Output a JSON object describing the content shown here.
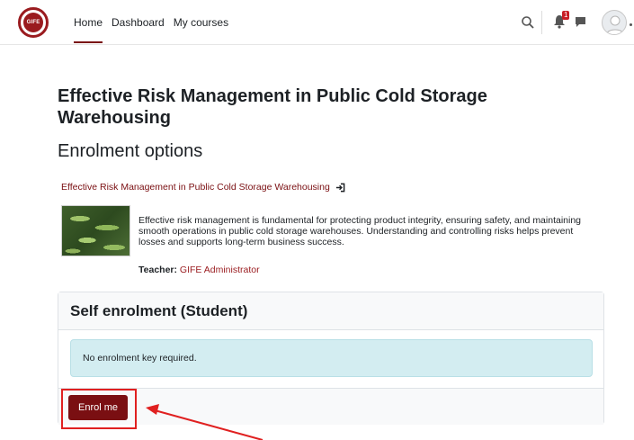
{
  "navbar": {
    "logo_text": "GIFE",
    "links": [
      {
        "label": "Home",
        "active": true
      },
      {
        "label": "Dashboard",
        "active": false
      },
      {
        "label": "My courses",
        "active": false
      }
    ],
    "notification_count": "1",
    "icons": [
      "search-icon",
      "bell-icon",
      "chat-icon",
      "avatar"
    ]
  },
  "course": {
    "title": "Effective Risk Management in Public Cold Storage Warehousing",
    "heading": "Enrolment options",
    "link_text": "Effective Risk Management in Public Cold Storage Warehousing",
    "summary": "Effective risk management is fundamental for protecting product integrity, ensuring safety, and maintaining smooth operations in public cold storage warehouses. Understanding and controlling risks helps prevent losses and supports long-term business success.",
    "teacher_label": "Teacher:",
    "teacher_name": "GIFE Administrator"
  },
  "enrolment": {
    "title": "Self enrolment (Student)",
    "notice": "No enrolment key required.",
    "button_label": "Enrol me"
  },
  "colors": {
    "brand": "#7a0f12",
    "annotation": "#e02020",
    "alert_bg": "#d3edf1"
  }
}
